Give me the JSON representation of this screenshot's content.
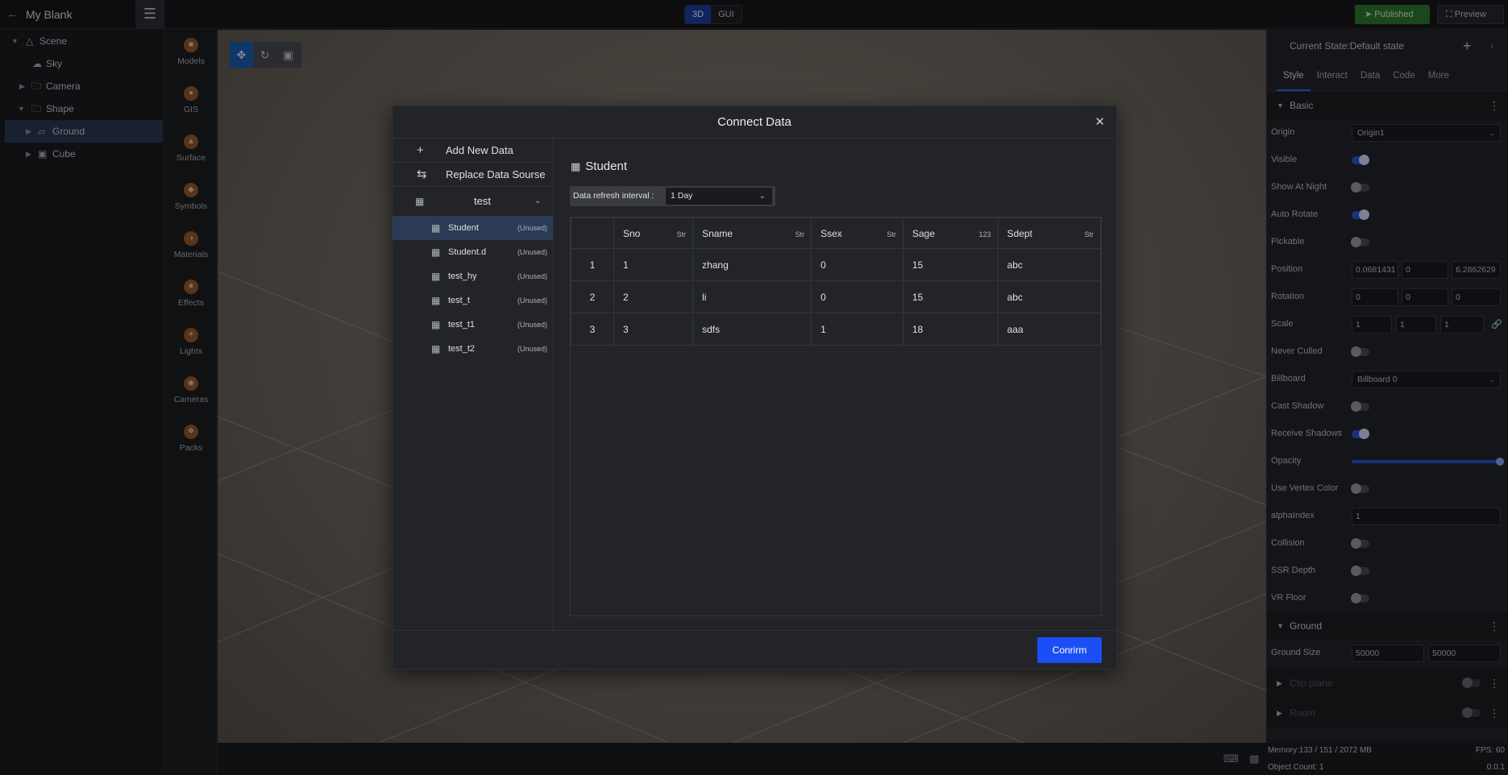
{
  "topbar": {
    "project_title": "My Blank",
    "mode_tabs": [
      "3D",
      "GUI"
    ],
    "active_mode": "3D",
    "published_label": "Published",
    "preview_label": "Preview"
  },
  "scene_tree": {
    "items": [
      {
        "label": "Scene",
        "level": 0,
        "icon": "scene-icon",
        "caret": "down"
      },
      {
        "label": "Sky",
        "level": 1,
        "icon": "sky-icon",
        "caret": ""
      },
      {
        "label": "Camera",
        "level": 1,
        "icon": "folder-icon",
        "caret": "right"
      },
      {
        "label": "Shape",
        "level": 1,
        "icon": "folder-icon",
        "caret": "down"
      },
      {
        "label": "Ground",
        "level": 2,
        "icon": "plane-icon",
        "caret": "right",
        "selected": true
      },
      {
        "label": "Cube",
        "level": 2,
        "icon": "cube-icon",
        "caret": "right"
      }
    ]
  },
  "library": {
    "items": [
      "Models",
      "GIS",
      "Surface",
      "Symbols",
      "Materials",
      "Effects",
      "Lights",
      "Cameras",
      "Packs"
    ]
  },
  "right_panel": {
    "state_label": "Current State:Default state",
    "tabs": [
      "Style",
      "Interact",
      "Data",
      "Code",
      "More"
    ],
    "active_tab": "Style",
    "basic_section": "Basic",
    "origin_label": "Origin",
    "origin_value": "Origin1",
    "visible_label": "Visible",
    "show_at_night_label": "Show At Night",
    "auto_rotate_label": "Auto Rotate",
    "pickable_label": "Pickable",
    "position_label": "Position",
    "position": [
      "0.0681431",
      "0",
      "6.2862629"
    ],
    "rotation_label": "Rotation",
    "rotation": [
      "0",
      "0",
      "0"
    ],
    "scale_label": "Scale",
    "scale": [
      "1",
      "1",
      "1"
    ],
    "never_culled_label": "Never Culled",
    "billboard_label": "Billboard",
    "billboard_value": "Billboard 0",
    "cast_shadow_label": "Cast Shadow",
    "receive_shadows_label": "Receive Shadows",
    "opacity_label": "Opacity",
    "opacity_value": 1.0,
    "use_vertex_color_label": "Use Vertex Color",
    "alpha_index_label": "alphaIndex",
    "alpha_index_value": "1",
    "collision_label": "Collision",
    "ssr_depth_label": "SSR Depth",
    "vr_floor_label": "VR Floor",
    "ground_section": "Ground",
    "ground_size_label": "Ground Size",
    "ground_size": [
      "50000",
      "50000"
    ],
    "clip_plane_section": "Clip plane",
    "room_section": "Room"
  },
  "status": {
    "memory": "Memory:133 / 151 / 2072 MB",
    "fps": "FPS: 60",
    "object_count": "Object Count: 1",
    "version": "0.0.1"
  },
  "modal": {
    "title": "Connect Data",
    "add_new_data": "Add New Data",
    "replace_data_source": "Replace Data Sourse",
    "group_name": "test",
    "tables": [
      {
        "name": "Student",
        "status": "(Unused)",
        "selected": true
      },
      {
        "name": "Student.d",
        "status": "(Unused)"
      },
      {
        "name": "test_hy",
        "status": "(Unused)"
      },
      {
        "name": "test_t",
        "status": "(Unused)"
      },
      {
        "name": "test_t1",
        "status": "(Unused)"
      },
      {
        "name": "test_t2",
        "status": "(Unused)"
      }
    ],
    "table_title": "Student",
    "refresh_label": "Data refresh interval :",
    "refresh_value": "1 Day",
    "columns": [
      {
        "name": "Sno",
        "type": "Str"
      },
      {
        "name": "Sname",
        "type": "Str"
      },
      {
        "name": "Ssex",
        "type": "Str"
      },
      {
        "name": "Sage",
        "type": "123"
      },
      {
        "name": "Sdept",
        "type": "Str"
      }
    ],
    "rows": [
      {
        "n": "1",
        "cells": [
          "1",
          "zhang",
          "0",
          "15",
          "abc"
        ]
      },
      {
        "n": "2",
        "cells": [
          "2",
          "li",
          "0",
          "15",
          "abc"
        ]
      },
      {
        "n": "3",
        "cells": [
          "3",
          "sdfs",
          "1",
          "18",
          "aaa"
        ]
      }
    ],
    "confirm_label": "Conrirm"
  },
  "colors": {
    "accent": "#1b4ff5",
    "published": "#2d7a33",
    "selection": "#2b3a55"
  }
}
